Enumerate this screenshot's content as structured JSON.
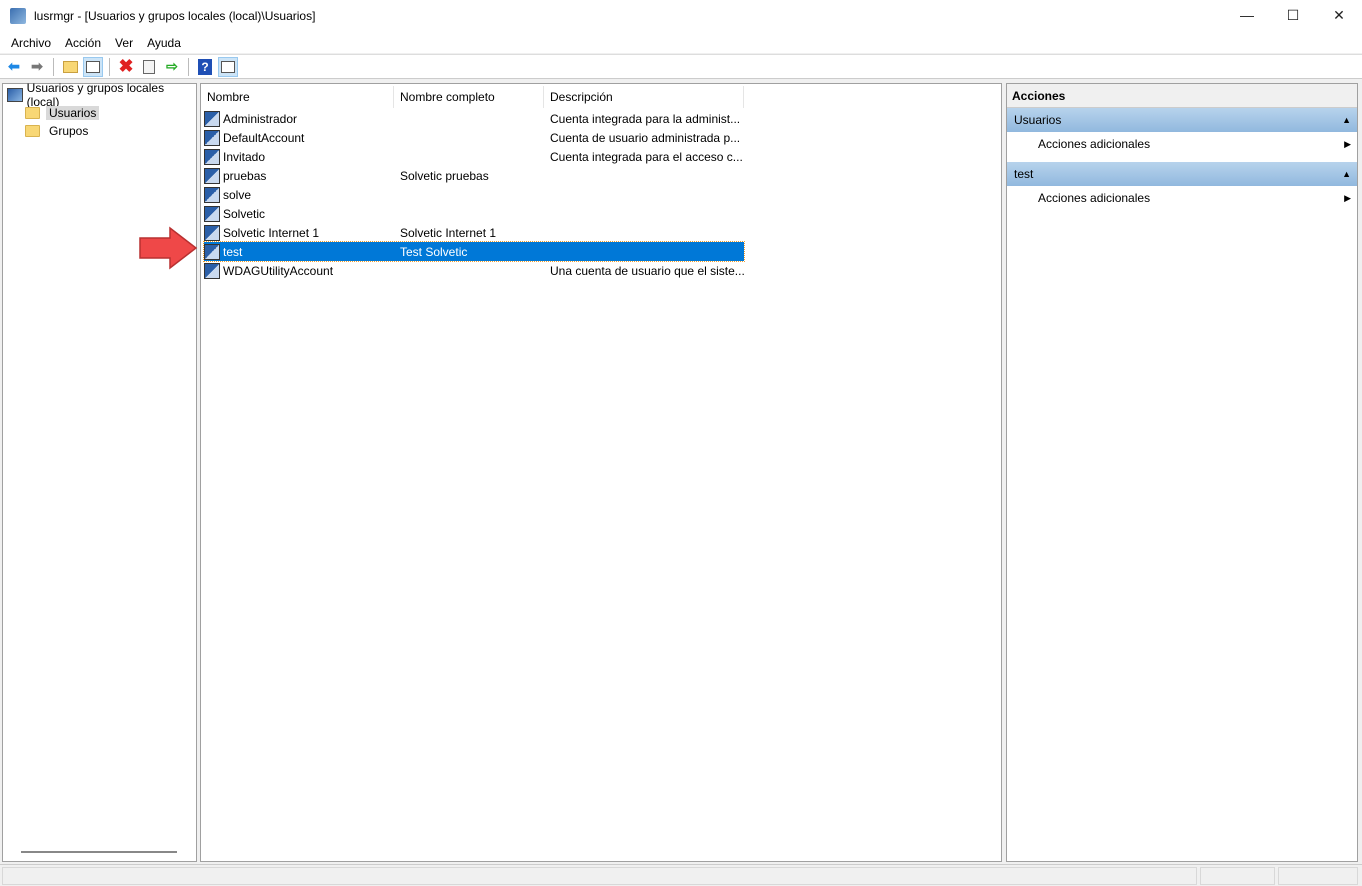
{
  "window": {
    "title": "lusrmgr - [Usuarios y grupos locales (local)\\Usuarios]",
    "minimize": "—",
    "maximize": "☐",
    "close": "✕"
  },
  "menu": [
    "Archivo",
    "Acción",
    "Ver",
    "Ayuda"
  ],
  "toolbar": [
    "back-icon",
    "forward-icon",
    "up-folder-icon",
    "show-hide-tree-icon",
    "delete-icon",
    "properties-icon",
    "export-icon",
    "help-icon",
    "show-hide-action-pane-icon"
  ],
  "tree": {
    "root": "Usuarios y grupos locales (local)",
    "items": [
      "Usuarios",
      "Grupos"
    ],
    "selected": "Usuarios"
  },
  "list": {
    "columns": [
      "Nombre",
      "Nombre completo",
      "Descripción"
    ],
    "rows": [
      {
        "name": "Administrador",
        "full": "",
        "desc": "Cuenta integrada para la administ..."
      },
      {
        "name": "DefaultAccount",
        "full": "",
        "desc": "Cuenta de usuario administrada p..."
      },
      {
        "name": "Invitado",
        "full": "",
        "desc": "Cuenta integrada para el acceso c..."
      },
      {
        "name": "pruebas",
        "full": "Solvetic pruebas",
        "desc": ""
      },
      {
        "name": "solve",
        "full": "",
        "desc": ""
      },
      {
        "name": "Solvetic",
        "full": "",
        "desc": ""
      },
      {
        "name": "Solvetic Internet 1",
        "full": "Solvetic Internet 1",
        "desc": ""
      },
      {
        "name": "test",
        "full": "Test Solvetic",
        "desc": ""
      },
      {
        "name": "WDAGUtilityAccount",
        "full": "",
        "desc": "Una cuenta de usuario que el siste..."
      }
    ],
    "selected": "test"
  },
  "actions": {
    "title": "Acciones",
    "groups": [
      {
        "label": "Usuarios",
        "item": "Acciones adicionales"
      },
      {
        "label": "test",
        "item": "Acciones adicionales"
      }
    ]
  },
  "colors": {
    "selection": "#0078d7",
    "arrow": "#e84545",
    "group": "#a9c9e8"
  }
}
